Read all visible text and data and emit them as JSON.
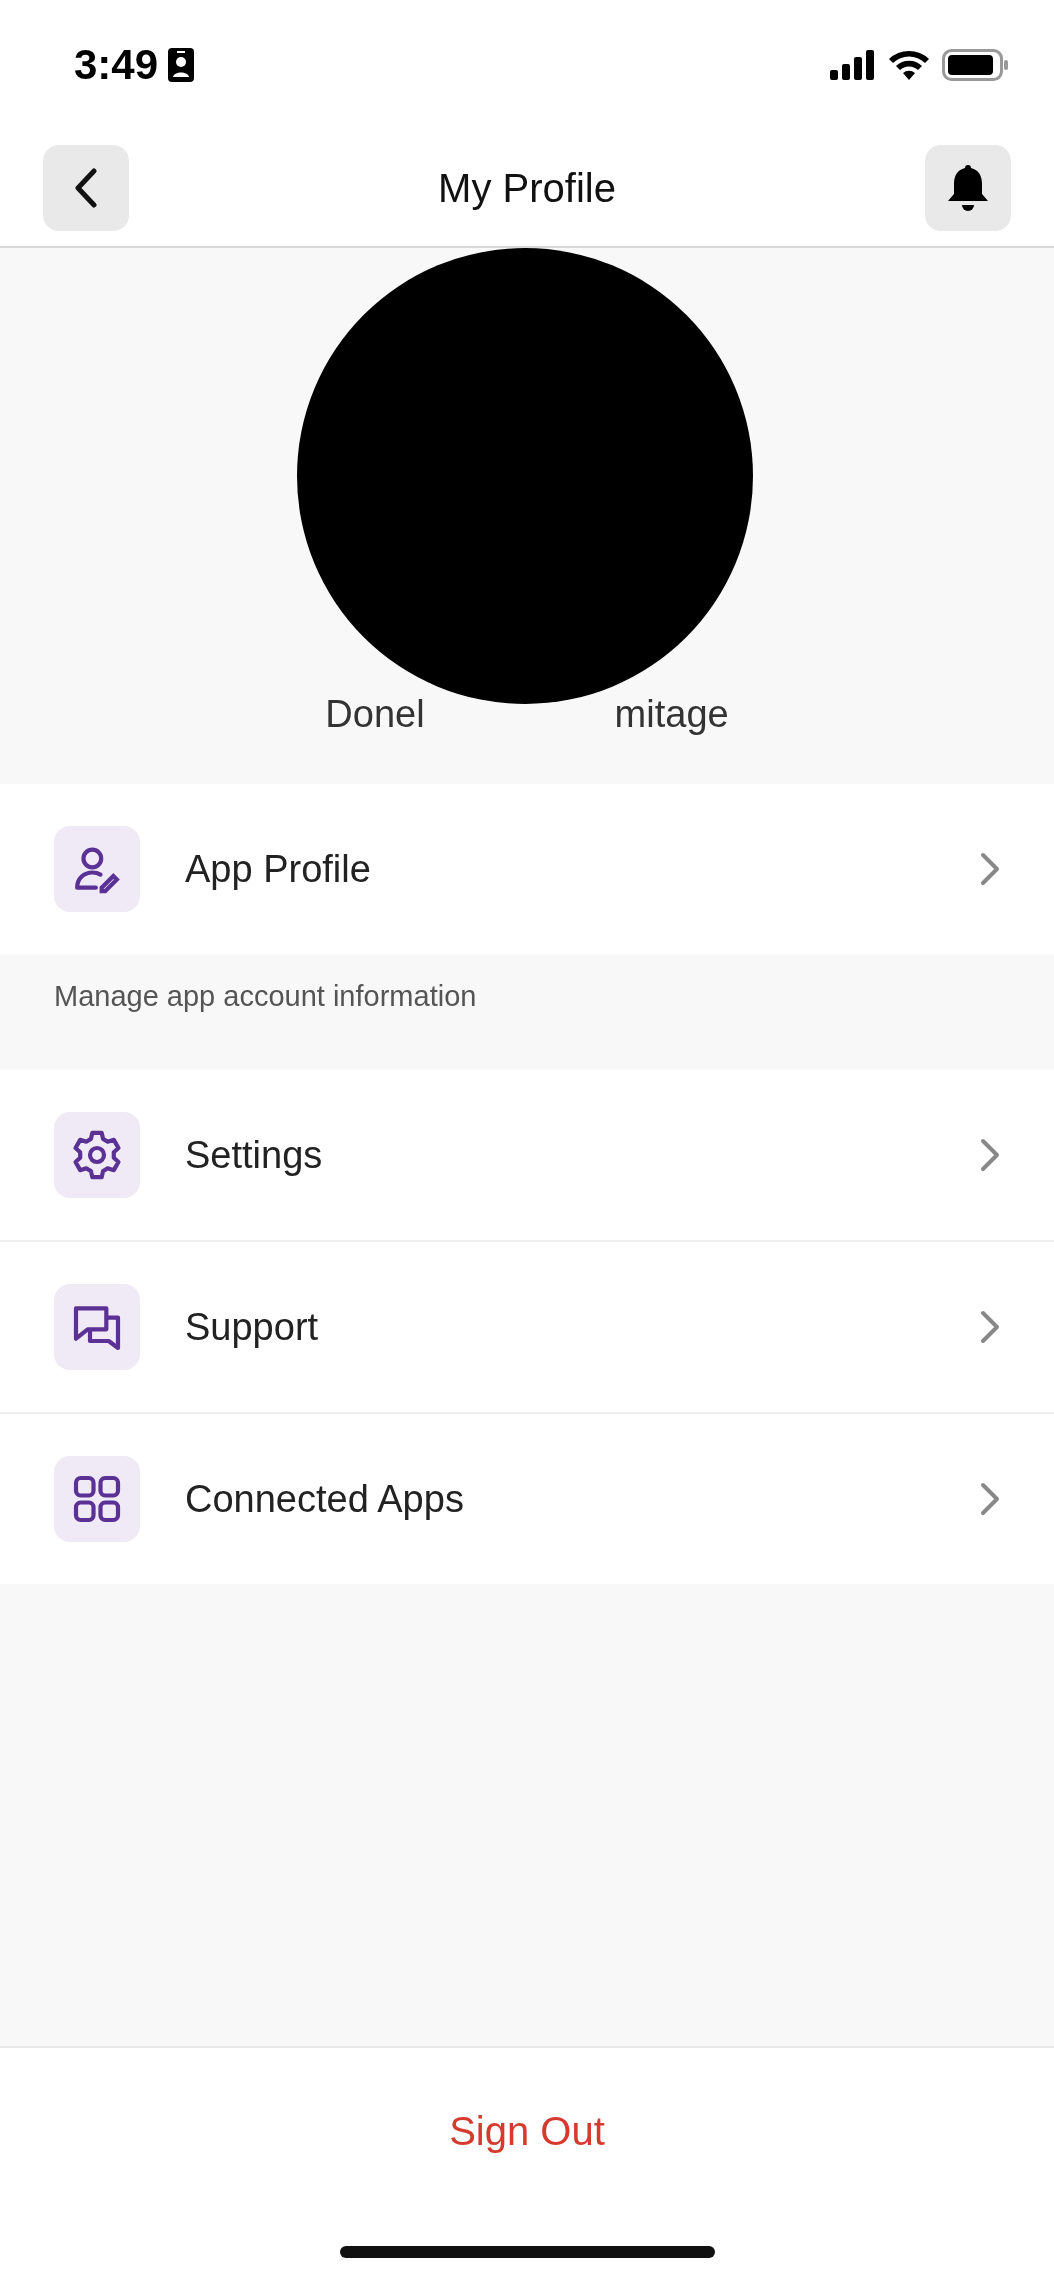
{
  "status_bar": {
    "time": "3:49"
  },
  "header": {
    "title": "My Profile"
  },
  "profile": {
    "name_visible_start": "Donel",
    "name_visible_end": "mitage"
  },
  "sections": [
    {
      "items": [
        {
          "label": "App Profile",
          "kind": "profile"
        }
      ],
      "caption": "Manage app account information"
    },
    {
      "items": [
        {
          "label": "Settings",
          "kind": "gear"
        },
        {
          "label": "Support",
          "kind": "chat"
        },
        {
          "label": "Connected Apps",
          "kind": "grid"
        }
      ]
    }
  ],
  "footer": {
    "sign_out": "Sign Out"
  }
}
